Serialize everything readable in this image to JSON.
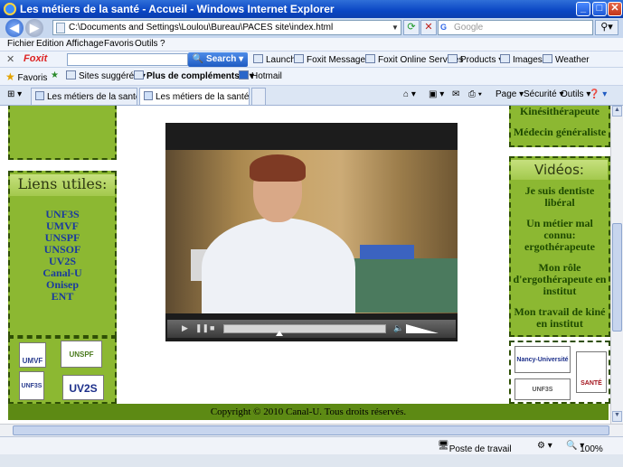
{
  "window": {
    "title": "Les métiers de la santé - Accueil - Windows Internet Explorer",
    "min_label": "_",
    "max_label": "□",
    "close_label": "✕"
  },
  "addressbar": {
    "url": "C:\\Documents and Settings\\Loulou\\Bureau\\PACES site\\index.html",
    "search_placeholder": "Google"
  },
  "menu": [
    "Fichier",
    "Edition",
    "Affichage",
    "Favoris",
    "Outils",
    "?"
  ],
  "foxit": {
    "brand": "Foxit",
    "search_label": "Search",
    "items": [
      "Launch",
      "Foxit Messages",
      "Foxit Online Services",
      "Products",
      "Images",
      "Weather"
    ]
  },
  "favorites": {
    "label": "Favoris",
    "items": [
      "Sites suggérés",
      "Plus de compléments...",
      "Hotmail"
    ]
  },
  "tabs": [
    {
      "label": "Les métiers de la santé - Acc..."
    },
    {
      "label": "Les métiers de la santé - ..."
    }
  ],
  "commands": [
    "Page",
    "Sécurité",
    "Outils"
  ],
  "left": {
    "links_title": "Liens utiles:",
    "links": [
      "UNF3S",
      "UMVF",
      "UNSPF",
      "UNSOF",
      "UV2S",
      "Canal-U",
      "Onisep",
      "ENT"
    ],
    "logos": [
      "UMVF",
      "UNSPF",
      "UNF3S",
      "UV2S"
    ]
  },
  "right": {
    "top_links": [
      "Kinésithérapeute",
      "Médecin généraliste"
    ],
    "videos_title": "Vidéos:",
    "videos": [
      "Je suis dentiste libéral",
      "Un métier mal connu: ergothérapeute",
      "Mon rôle d'ergothérapeute en institut",
      "Mon travail de kiné en institut"
    ],
    "logos": [
      "Nancy-Université",
      "UNF3S",
      "SANTÉ"
    ]
  },
  "player": {
    "progress": 0.34,
    "volume": 0.9
  },
  "footer": "Copyright © 2010 Canal-U. Tous droits réservés.",
  "status": {
    "zone": "Poste de travail",
    "zoom": "100%"
  }
}
